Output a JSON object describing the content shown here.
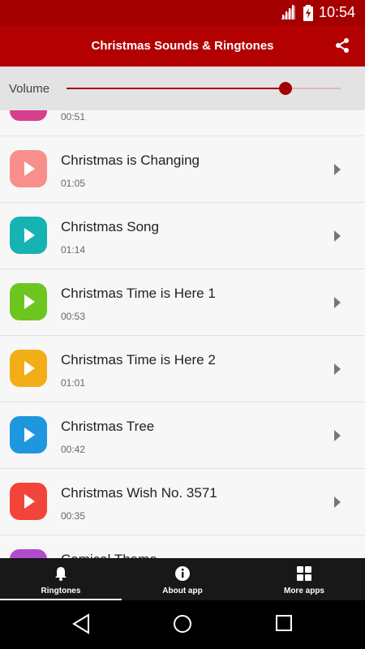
{
  "status_bar": {
    "time": "10:54"
  },
  "app_bar": {
    "title": "Christmas Sounds & Ringtones",
    "share_icon": "share-icon"
  },
  "volume": {
    "label": "Volume",
    "level": 0.8
  },
  "ringtones": [
    {
      "name": "",
      "duration": "00:51",
      "color": "#d63f8c"
    },
    {
      "name": "Christmas is Changing",
      "duration": "01:05",
      "color": "#f98f8a"
    },
    {
      "name": "Christmas Song",
      "duration": "01:14",
      "color": "#16b3b3"
    },
    {
      "name": "Christmas Time is Here 1",
      "duration": "00:53",
      "color": "#6cc61f"
    },
    {
      "name": "Christmas Time is Here 2",
      "duration": "01:01",
      "color": "#f2ae16"
    },
    {
      "name": "Christmas Tree",
      "duration": "00:42",
      "color": "#1e97df"
    },
    {
      "name": "Christmas Wish No. 3571",
      "duration": "00:35",
      "color": "#f2443a"
    },
    {
      "name": "Comical Theme",
      "duration": "",
      "color": "#b14ccf"
    }
  ],
  "bottom_nav": {
    "tabs": [
      {
        "label": "Ringtones",
        "icon": "bell-icon",
        "active": true
      },
      {
        "label": "About app",
        "icon": "info-icon",
        "active": false
      },
      {
        "label": "More apps",
        "icon": "grid-icon",
        "active": false
      }
    ]
  },
  "colors": {
    "primary": "#b30000",
    "status": "#a50000",
    "accent": "#a30000"
  }
}
